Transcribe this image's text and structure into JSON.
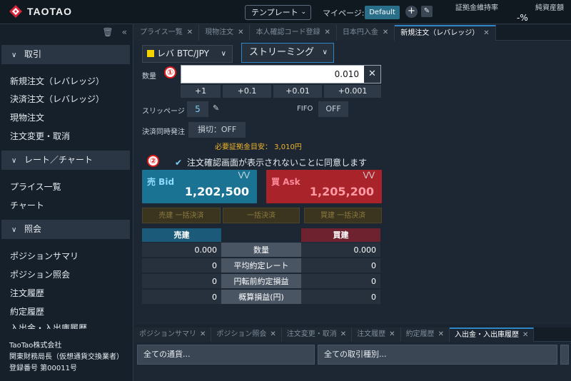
{
  "header": {
    "logo_text": "TAOTAO",
    "template_label": "テンプレート",
    "mypage_label": "マイページ:",
    "mypage_value": "Default",
    "kpi1_label": "証拠金維持率",
    "kpi1_value": "-%",
    "kpi2_label": "純資産額"
  },
  "sidebar": {
    "sections": [
      {
        "label": "取引",
        "items": [
          "新規注文（レバレッジ）",
          "決済注文（レバレッジ）",
          "現物注文",
          "注文変更・取消"
        ]
      },
      {
        "label": "レート／チャート",
        "items": [
          "プライス一覧",
          "チャート"
        ]
      },
      {
        "label": "照会",
        "items": [
          "ポジションサマリ",
          "ポジション照会",
          "注文履歴",
          "約定履歴",
          "入出金・入出庫履歴"
        ]
      }
    ],
    "company": [
      "TaoTao株式会社",
      "関東財務局長（仮想通貨交換業者）",
      "登録番号 第00011号"
    ]
  },
  "tabs": [
    "プライス一覧",
    "現物注文",
    "本人確認コード登録",
    "日本円入金",
    "新規注文（レバレッジ）"
  ],
  "order": {
    "pair": "レバ BTC/JPY",
    "mode": "ストリーミング",
    "qty_label": "数量",
    "qty_value": "0.010",
    "increments": [
      "+1",
      "+0.1",
      "+0.01",
      "+0.001"
    ],
    "slippage_label": "スリッページ",
    "slippage_value": "5",
    "fifo_label": "FIFO",
    "fifo_value": "OFF",
    "settle_label": "決済同時発注",
    "settle_value": "損切：OFF",
    "margin_text": "必要証拠金目安： 3,010円",
    "agree_text": "注文確認画面が表示されないことに同意します",
    "marker1": "①",
    "marker2": "②",
    "bid_label": "売 Bid",
    "bid_value": "1,202,500",
    "ask_label": "買 Ask",
    "ask_value": "1,205,200",
    "bulk": [
      "売建 一括決済",
      "一括決済",
      "買建 一括決済"
    ]
  },
  "positions": {
    "sell_header": "売建",
    "buy_header": "買建",
    "rows": [
      {
        "label": "数量",
        "sell": "0.000",
        "buy": "0.000"
      },
      {
        "label": "平均約定レート",
        "sell": "0",
        "buy": "0"
      },
      {
        "label": "円転前約定損益",
        "sell": "0",
        "buy": "0"
      },
      {
        "label": "概算損益(円)",
        "sell": "0",
        "buy": "0"
      }
    ]
  },
  "bottom_tabs": [
    "ポジションサマリ",
    "ポジション照会",
    "注文変更・取消",
    "注文履歴",
    "約定履歴",
    "入出金・入出庫履歴"
  ],
  "filters": {
    "currency": "全ての通貨...",
    "type": "全ての取引種別..."
  }
}
